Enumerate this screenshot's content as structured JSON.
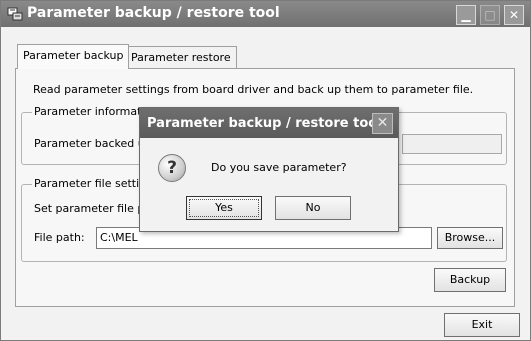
{
  "window": {
    "title": "Parameter backup / restore tool",
    "minimize_glyph": "▁",
    "maximize_glyph": "□",
    "close_glyph": "✕"
  },
  "tabs": [
    {
      "label": "Parameter backup",
      "active": true
    },
    {
      "label": "Parameter restore",
      "active": false
    }
  ],
  "backup_tab": {
    "description": "Read parameter settings from board driver and back up them to parameter file.",
    "info_group": {
      "legend": "Parameter informatio",
      "text": "Parameter backed u"
    },
    "file_group": {
      "legend": "Parameter file setting",
      "instruction": "Set parameter file pa",
      "path_label": "File path:",
      "path_value": "C:\\MEL",
      "browse_label": "Browse..."
    },
    "backup_label": "Backup"
  },
  "exit_label": "Exit",
  "dialog": {
    "title": "Parameter backup / restore tool",
    "close_glyph": "✕",
    "icon_glyph": "?",
    "message": "Do you save parameter?",
    "yes_label": "Yes",
    "no_label": "No"
  }
}
